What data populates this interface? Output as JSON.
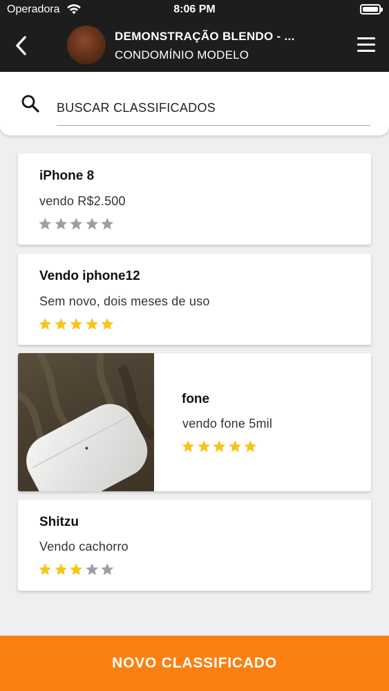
{
  "status_bar": {
    "carrier": "Operadora",
    "time": "8:06 PM"
  },
  "header": {
    "title": "DEMONSTRAÇÃO BLENDO - ...",
    "subtitle": "CONDOMÍNIO MODELO",
    "back_icon": "chevron-left-icon",
    "menu_icon": "hamburger-menu-icon"
  },
  "search": {
    "placeholder": "BUSCAR CLASSIFICADOS",
    "icon": "search-icon"
  },
  "listings": [
    {
      "title": "iPhone 8",
      "description": "vendo R$2.500",
      "rating": 0,
      "has_photo": false
    },
    {
      "title": "Vendo iphone12",
      "description": "Sem novo, dois meses de uso",
      "rating": 5,
      "has_photo": true
    },
    {
      "title": "fone",
      "description": "vendo fone 5mil",
      "rating": 5,
      "has_photo": true
    },
    {
      "title": "Shitzu",
      "description": "Vendo cachorro",
      "rating": 3,
      "has_photo": false
    }
  ],
  "footer": {
    "new_button_label": "NOVO CLASSIFICADO"
  },
  "colors": {
    "header_bg": "#1d1d1d",
    "accent_orange": "#fb8010",
    "star_filled": "#f5c518",
    "star_empty": "#9e9e9e",
    "page_bg": "#efeff1"
  }
}
